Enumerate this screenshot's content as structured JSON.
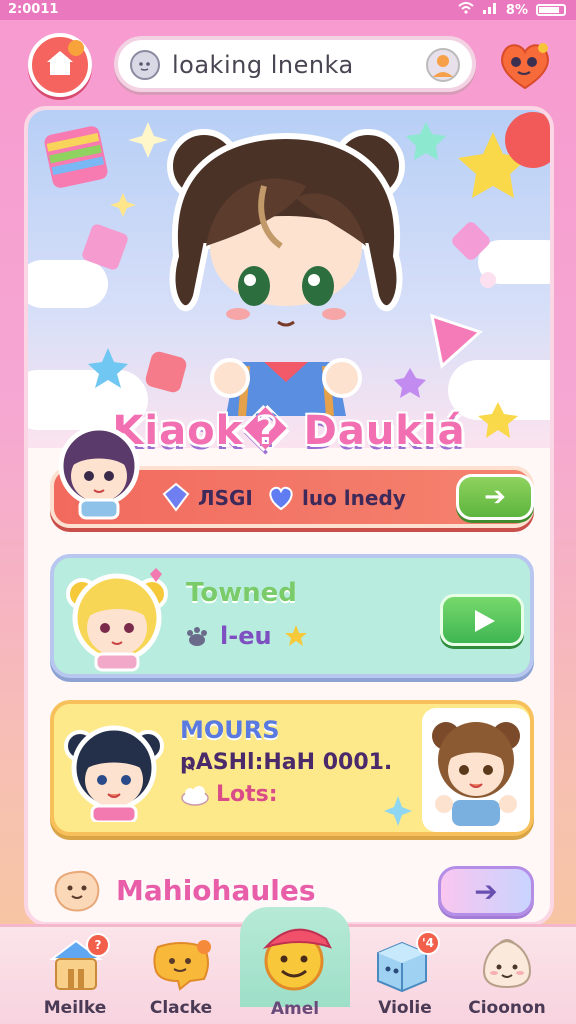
{
  "status_bar": {
    "time": "2:0011",
    "battery": "8%"
  },
  "search": {
    "placeholder": "loaking lnenka"
  },
  "hero": {
    "title": "Kiaok� Daukiá"
  },
  "card1": {
    "stat1": "ЛSGI",
    "stat2": "luo lnedy",
    "arrow": "➔"
  },
  "card2": {
    "title": "Towned",
    "subtitle": "l-eu"
  },
  "card3": {
    "title": "MOURS",
    "line1": "ҏASHl:HaH 0001.",
    "line2": "Lots:"
  },
  "row4": {
    "label": "Mahiohaules",
    "arrow": "➔"
  },
  "nav": {
    "items": [
      {
        "label": "Meilke",
        "badge": "?"
      },
      {
        "label": "Clacke",
        "badge": ""
      },
      {
        "label": "Amel",
        "badge": ""
      },
      {
        "label": "Violie",
        "badge": "'4"
      },
      {
        "label": "Cioonon",
        "badge": ""
      }
    ]
  },
  "colors": {
    "accent_pink": "#f26fb2",
    "primary_green": "#5cb53e",
    "coral": "#f26a5e",
    "mint": "#b8ecde",
    "yellow": "#fde98a"
  }
}
